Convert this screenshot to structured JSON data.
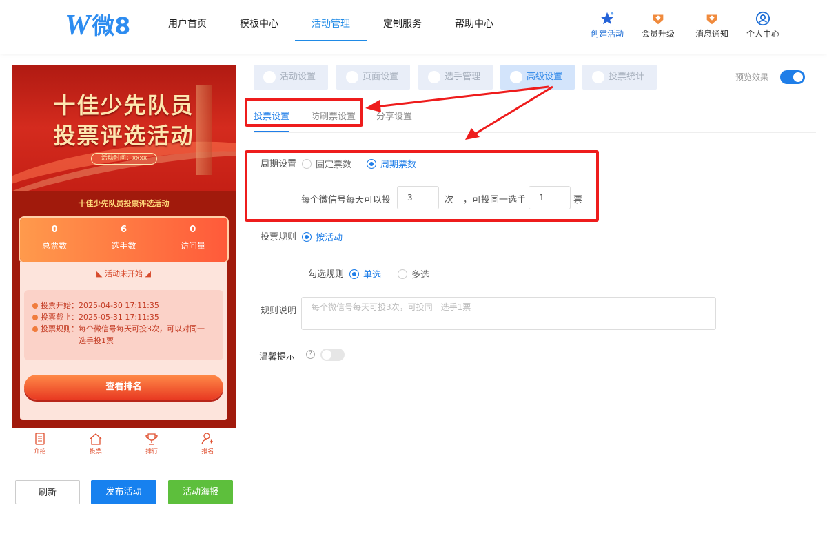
{
  "header": {
    "logo_w": "W",
    "logo_text": "微8",
    "nav": [
      "用户首页",
      "模板中心",
      "活动管理",
      "定制服务",
      "帮助中心"
    ],
    "actions": {
      "create": "创建活动",
      "upgrade": "会员升级",
      "notify": "消息通知",
      "profile": "个人中心"
    }
  },
  "phone": {
    "banner_line1": "十佳少先队员",
    "banner_line2": "投票评选活动",
    "banner_time": "活动时间：xxxx",
    "subtitle": "十佳少先队员投票评选活动",
    "stats": [
      {
        "value": "0",
        "label": "总票数"
      },
      {
        "value": "6",
        "label": "选手数"
      },
      {
        "value": "0",
        "label": "访问量"
      }
    ],
    "status": "活动未开始",
    "info": [
      {
        "key": "投票开始：",
        "value": "2025-04-30 17:11:35"
      },
      {
        "key": "投票截止：",
        "value": "2025-05-31 17:11:35"
      },
      {
        "key": "投票规则：",
        "value": "每个微信号每天可投3次，可以对同一选手投1票"
      }
    ],
    "rank_button": "查看排名",
    "tabbar": [
      "介绍",
      "投票",
      "排行",
      "报名"
    ]
  },
  "buttons": {
    "refresh": "刷新",
    "publish": "发布活动",
    "poster": "活动海报"
  },
  "subtabs": [
    "活动设置",
    "页面设置",
    "选手管理",
    "高级设置",
    "投票统计"
  ],
  "preview": "预览效果",
  "content_tabs": [
    "投票设置",
    "防刷票设置",
    "分享设置"
  ],
  "form": {
    "period_label": "周期设置",
    "period_fixed": "固定票数",
    "period_cycle": "周期票数",
    "daily_prefix": "每个微信号每天可以投",
    "daily_value": "3",
    "daily_unit": "次",
    "same_prefix": "，可投同一选手",
    "same_value": "1",
    "same_unit": "票",
    "rule_label": "投票规则",
    "rule_by_activity": "按活动",
    "select_label": "勾选规则",
    "select_single": "单选",
    "select_multi": "多选",
    "desc_label": "规则说明",
    "desc_placeholder": "每个微信号每天可投3次，可投同一选手1票",
    "tip_label": "温馨提示",
    "tip_q": "?"
  }
}
